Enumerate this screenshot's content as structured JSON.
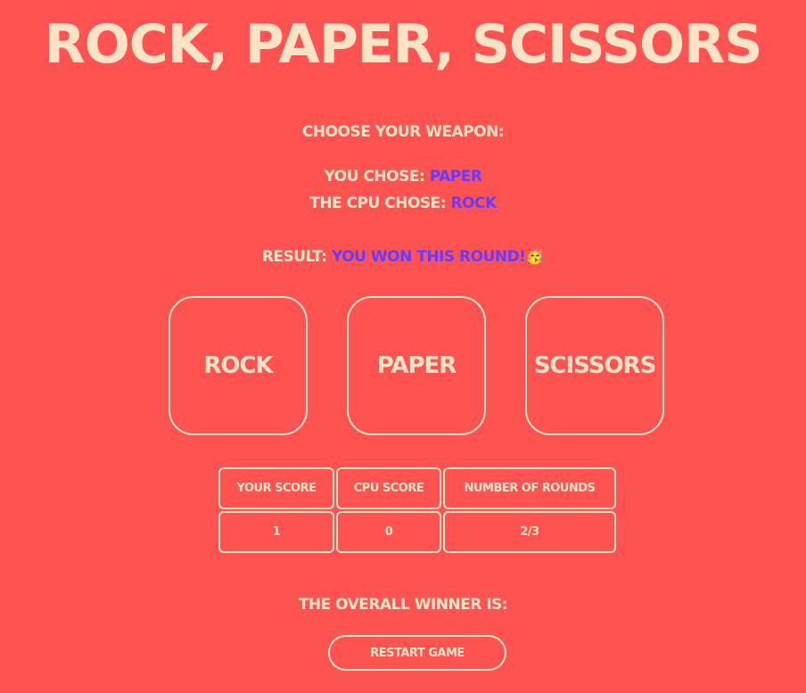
{
  "title": "ROCK, PAPER, SCISSORS",
  "prompt": "CHOOSE YOUR WEAPON:",
  "player_choice": {
    "label": "YOU CHOSE:",
    "value": "PAPER"
  },
  "cpu_choice": {
    "label": "THE CPU CHOSE:",
    "value": "ROCK"
  },
  "result": {
    "label": "RESULT:",
    "value": "YOU WON THIS ROUND!",
    "emoji": "🥳",
    "emoji_name": "party-face-icon"
  },
  "buttons": {
    "rock": "ROCK",
    "paper": "PAPER",
    "scissors": "SCISSORS"
  },
  "scoreboard": {
    "headers": {
      "your_score": "YOUR SCORE",
      "cpu_score": "CPU SCORE",
      "rounds": "NUMBER OF ROUNDS"
    },
    "values": {
      "your_score": "1",
      "cpu_score": "0",
      "rounds": "2/3"
    }
  },
  "overall_winner": {
    "label": "THE OVERALL WINNER IS:"
  },
  "restart_label": "RESTART GAME",
  "colors": {
    "background": "#ff5351",
    "text": "#fde3c6",
    "accent": "#6a38ff"
  }
}
